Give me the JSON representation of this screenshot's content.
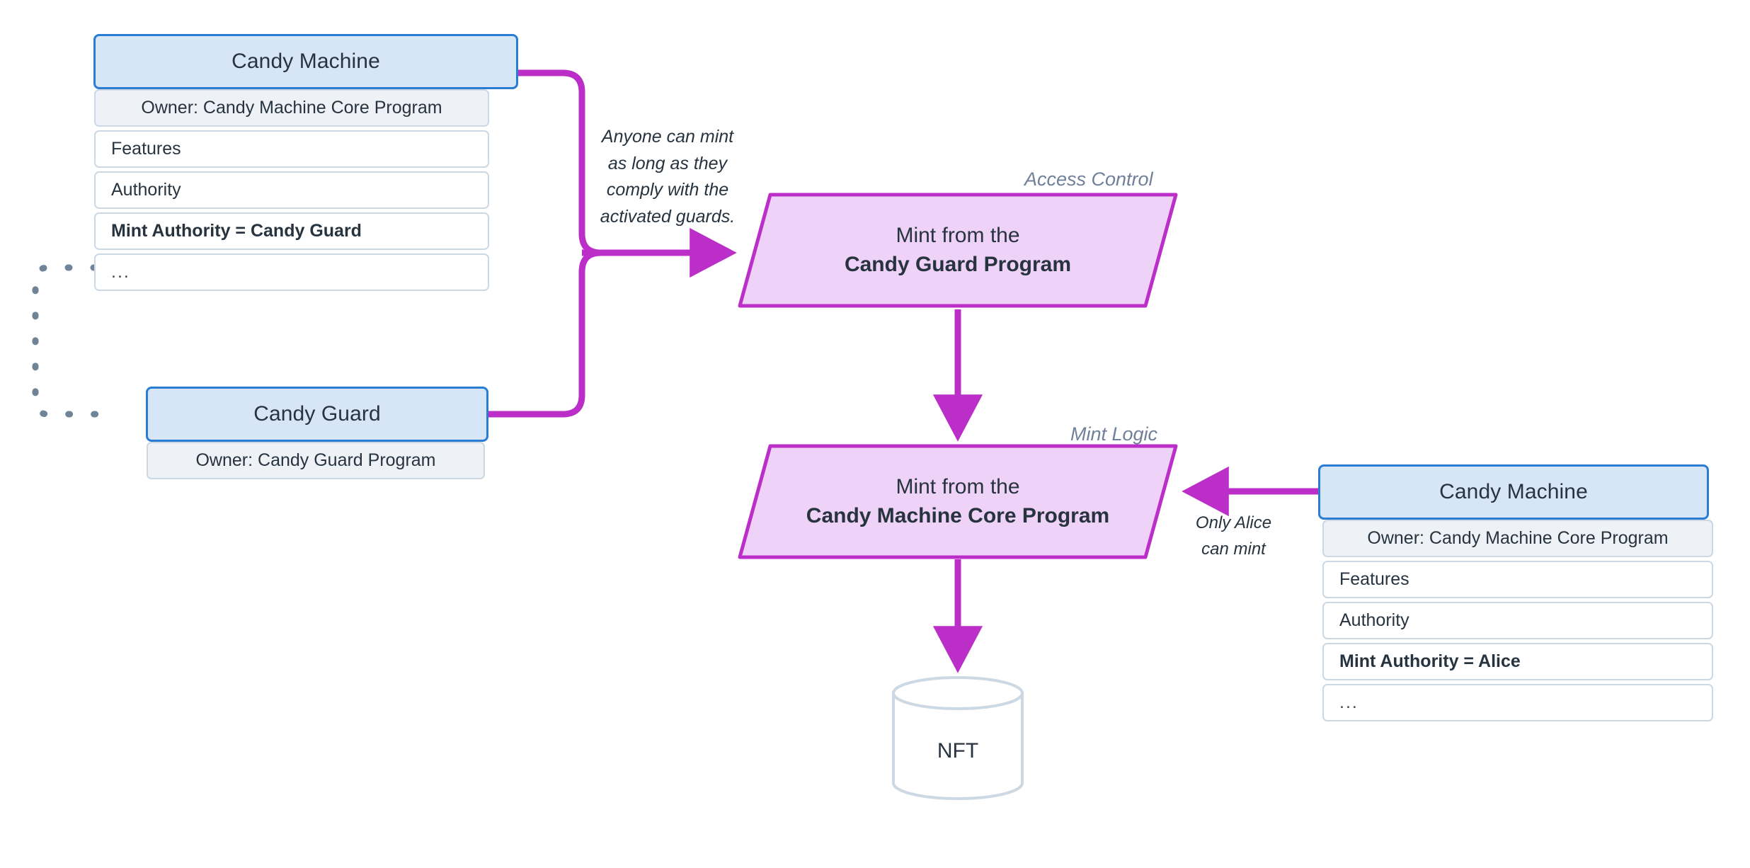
{
  "theme": {
    "background": "#ffffff",
    "node_border_blue": "#2b7cd3",
    "node_fill_blue": "#d6e6f7",
    "row_border": "#ccd8e3",
    "row_fill_owner": "#eef2f7",
    "process_stroke": "#bb2fc8",
    "process_fill": "#efd2f7",
    "arrow_purple": "#bb2fc8",
    "dashed_gray": "#708499",
    "caption_gray": "#70809a",
    "text_dark": "#27333f",
    "cylinder_stroke": "#ccd8e3"
  },
  "nodes": {
    "candy_machine_left": {
      "title": "Candy Machine",
      "rows": [
        {
          "text": "Owner: Candy Machine Core Program",
          "style": "owner"
        },
        {
          "text": "Features",
          "style": "plain"
        },
        {
          "text": "Authority",
          "style": "plain"
        },
        {
          "text": "Mint Authority = Candy Guard",
          "style": "bold"
        },
        {
          "text": "...",
          "style": "ellipsis"
        }
      ]
    },
    "candy_guard": {
      "title": "Candy Guard",
      "rows": [
        {
          "text": "Owner: Candy Guard Program",
          "style": "owner"
        }
      ]
    },
    "candy_machine_right": {
      "title": "Candy Machine",
      "rows": [
        {
          "text": "Owner: Candy Machine Core Program",
          "style": "owner"
        },
        {
          "text": "Features",
          "style": "plain"
        },
        {
          "text": "Authority",
          "style": "plain"
        },
        {
          "text": "Mint Authority = Alice",
          "style": "bold"
        },
        {
          "text": "...",
          "style": "ellipsis"
        }
      ]
    },
    "access_control": {
      "caption": "Access Control",
      "line1": "Mint from the",
      "line2": "Candy Guard Program"
    },
    "mint_logic": {
      "caption": "Mint Logic",
      "line1": "Mint from the",
      "line2": "Candy Machine Core Program"
    },
    "nft": {
      "label": "NFT"
    }
  },
  "edges": {
    "anyone_can_mint_note": "Anyone can mint\nas long as they\ncomply with the\nactivated guards.",
    "only_alice_note": "Only Alice\ncan mint"
  }
}
